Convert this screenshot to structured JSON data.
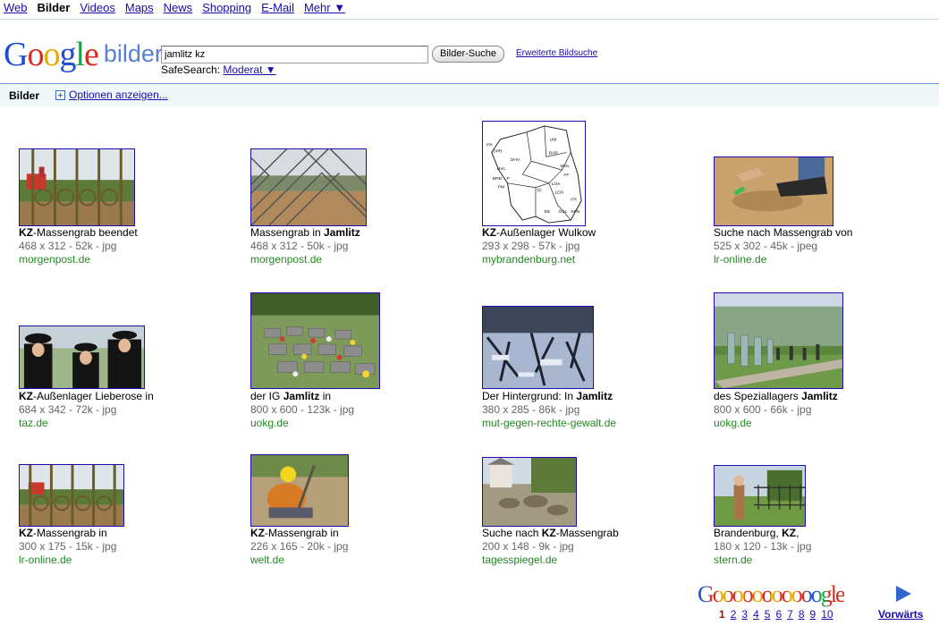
{
  "topnav": {
    "web": "Web",
    "bilder": "Bilder",
    "videos": "Videos",
    "maps": "Maps",
    "news": "News",
    "shopping": "Shopping",
    "email": "E-Mail",
    "mehr": "Mehr ▼"
  },
  "header": {
    "logo_G": "G",
    "logo_o1": "o",
    "logo_o2": "o",
    "logo_g": "g",
    "logo_l": "l",
    "logo_e": "e",
    "logo_sub": "bilder",
    "query": "jamlitz kz",
    "search_button": "Bilder-Suche",
    "advanced_link": "Erweiterte Bildsuche",
    "safesearch_label": "SafeSearch:",
    "safesearch_value": "Moderat ▼"
  },
  "bar": {
    "label": "Bilder",
    "options": "Optionen anzeigen..."
  },
  "results": [
    {
      "pre": "",
      "bold": "KZ",
      "post": "-Massengrab beendet",
      "meta": "468 x 312 - 52k - jpg",
      "source": "morgenpost.de"
    },
    {
      "pre": "Massengrab in ",
      "bold": "Jamlitz",
      "post": "",
      "meta": "468 x 312 - 50k - jpg",
      "source": "morgenpost.de"
    },
    {
      "pre": "",
      "bold": "KZ",
      "post": "-Außenlager Wulkow",
      "meta": "293 x 298 - 57k - jpg",
      "source": "mybrandenburg.net"
    },
    {
      "pre": "Suche nach Massengrab von",
      "bold": "",
      "post": "",
      "meta": "525 x 302 - 45k - jpeg",
      "source": "lr-online.de"
    },
    {
      "pre": "",
      "bold": "KZ",
      "post": "-Außenlager Lieberose in",
      "meta": "684 x 342 - 72k - jpg",
      "source": "taz.de"
    },
    {
      "pre": "der IG ",
      "bold": "Jamlitz",
      "post": " in",
      "meta": "800 x 600 - 123k - jpg",
      "source": "uokg.de"
    },
    {
      "pre": "Der Hintergrund: In ",
      "bold": "Jamlitz",
      "post": "",
      "meta": "380 x 285 - 86k - jpg",
      "source": "mut-gegen-rechte-gewalt.de"
    },
    {
      "pre": "des Speziallagers ",
      "bold": "Jamlitz",
      "post": "",
      "meta": "800 x 600 - 66k - jpg",
      "source": "uokg.de"
    },
    {
      "pre": "",
      "bold": "KZ",
      "post": "-Massengrab in",
      "meta": "300 x 175 - 15k - jpg",
      "source": "lr-online.de"
    },
    {
      "pre": "",
      "bold": "KZ",
      "post": "-Massengrab in",
      "meta": "226 x 165 - 20k - jpg",
      "source": "welt.de"
    },
    {
      "pre": "Suche nach ",
      "bold": "KZ",
      "post": "-Massengrab",
      "meta": "200 x 148 - 9k - jpg",
      "source": "tagesspiegel.de"
    },
    {
      "pre": "Brandenburg, ",
      "bold": "KZ",
      "post": ",",
      "meta": "180 x 120 - 13k - jpg",
      "source": "stern.de"
    }
  ],
  "map_labels": [
    "PR",
    "UM",
    "OPR",
    "BAR",
    "OHV",
    "MOL",
    "HVL",
    "FF",
    "BRB",
    "P",
    "LOS",
    "PM",
    "TF",
    "LDS",
    "FR",
    "EE",
    "OSL",
    "SPN"
  ],
  "pager": {
    "brand": "Gooooooooooogle",
    "current": "1",
    "pages": [
      "2",
      "3",
      "4",
      "5",
      "6",
      "7",
      "8",
      "9",
      "10"
    ],
    "next": "Vorwärts"
  },
  "colors": {
    "link": "#1a0dab",
    "source": "#228822",
    "meta": "#666666",
    "bar_bg": "#f0f7f9",
    "bar_border": "#6b90da"
  }
}
